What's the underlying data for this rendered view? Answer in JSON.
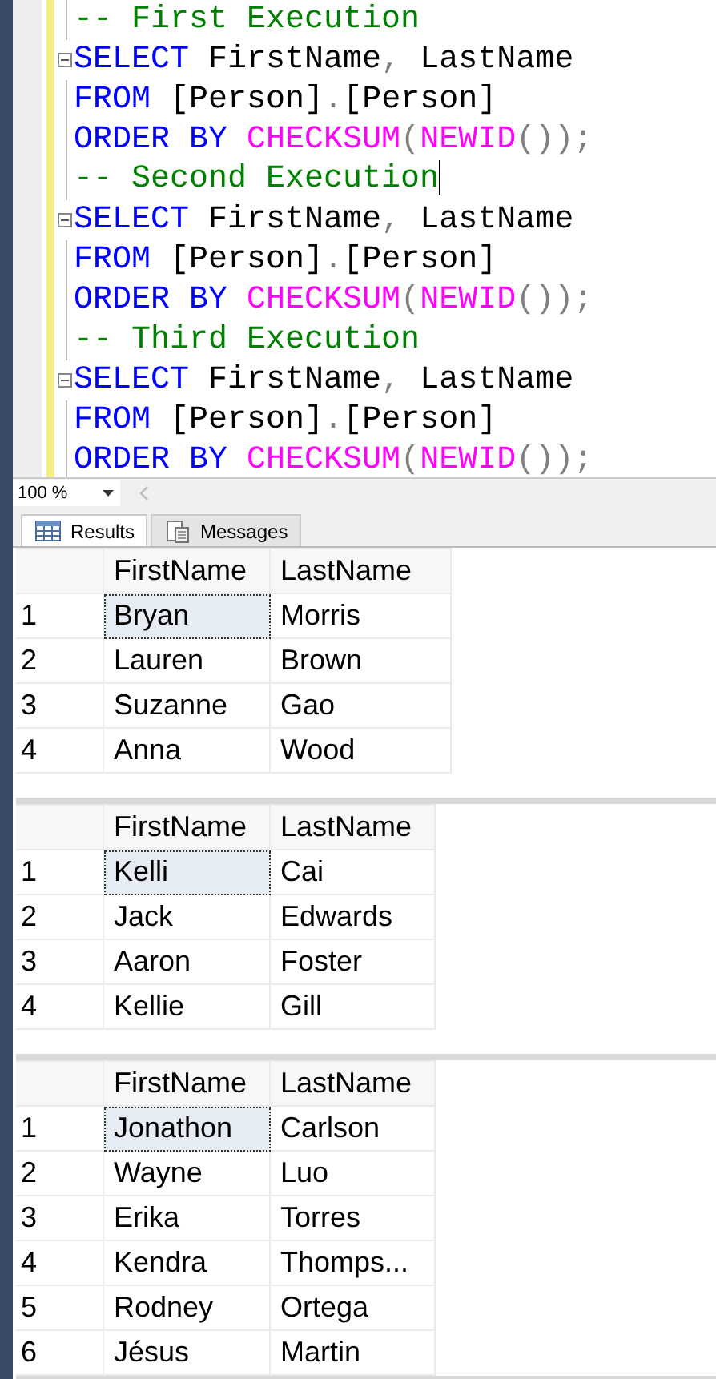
{
  "editor": {
    "lines": [
      {
        "fold": false,
        "caret": false,
        "tokens": [
          {
            "text": "-- First Execution",
            "kind": "comment"
          }
        ]
      },
      {
        "fold": true,
        "caret": false,
        "tokens": [
          {
            "text": "SELECT",
            "kind": "keyword"
          },
          {
            "text": " FirstName",
            "kind": "ident"
          },
          {
            "text": ",",
            "kind": "punct"
          },
          {
            "text": " LastName",
            "kind": "ident"
          }
        ]
      },
      {
        "fold": false,
        "caret": false,
        "tokens": [
          {
            "text": "FROM",
            "kind": "keyword"
          },
          {
            "text": " [Person]",
            "kind": "ident"
          },
          {
            "text": ".",
            "kind": "punct"
          },
          {
            "text": "[Person]",
            "kind": "ident"
          }
        ]
      },
      {
        "fold": false,
        "caret": false,
        "tokens": [
          {
            "text": "ORDER BY",
            "kind": "keyword"
          },
          {
            "text": " CHECKSUM",
            "kind": "function"
          },
          {
            "text": "(",
            "kind": "punct"
          },
          {
            "text": "NEWID",
            "kind": "function"
          },
          {
            "text": "());",
            "kind": "punct"
          }
        ]
      },
      {
        "fold": false,
        "caret": true,
        "tokens": [
          {
            "text": "-- Second Execution",
            "kind": "comment"
          }
        ]
      },
      {
        "fold": true,
        "caret": false,
        "tokens": [
          {
            "text": "SELECT",
            "kind": "keyword"
          },
          {
            "text": " FirstName",
            "kind": "ident"
          },
          {
            "text": ",",
            "kind": "punct"
          },
          {
            "text": " LastName",
            "kind": "ident"
          }
        ]
      },
      {
        "fold": false,
        "caret": false,
        "tokens": [
          {
            "text": "FROM",
            "kind": "keyword"
          },
          {
            "text": " [Person]",
            "kind": "ident"
          },
          {
            "text": ".",
            "kind": "punct"
          },
          {
            "text": "[Person]",
            "kind": "ident"
          }
        ]
      },
      {
        "fold": false,
        "caret": false,
        "tokens": [
          {
            "text": "ORDER BY",
            "kind": "keyword"
          },
          {
            "text": " CHECKSUM",
            "kind": "function"
          },
          {
            "text": "(",
            "kind": "punct"
          },
          {
            "text": "NEWID",
            "kind": "function"
          },
          {
            "text": "());",
            "kind": "punct"
          }
        ]
      },
      {
        "fold": false,
        "caret": false,
        "tokens": [
          {
            "text": "-- Third Execution",
            "kind": "comment"
          }
        ]
      },
      {
        "fold": true,
        "caret": false,
        "tokens": [
          {
            "text": "SELECT",
            "kind": "keyword"
          },
          {
            "text": " FirstName",
            "kind": "ident"
          },
          {
            "text": ",",
            "kind": "punct"
          },
          {
            "text": " LastName",
            "kind": "ident"
          }
        ]
      },
      {
        "fold": false,
        "caret": false,
        "tokens": [
          {
            "text": "FROM",
            "kind": "keyword"
          },
          {
            "text": " [Person]",
            "kind": "ident"
          },
          {
            "text": ".",
            "kind": "punct"
          },
          {
            "text": "[Person]",
            "kind": "ident"
          }
        ]
      },
      {
        "fold": false,
        "caret": false,
        "tokens": [
          {
            "text": "ORDER BY",
            "kind": "keyword"
          },
          {
            "text": " CHECKSUM",
            "kind": "function"
          },
          {
            "text": "(",
            "kind": "punct"
          },
          {
            "text": "NEWID",
            "kind": "function"
          },
          {
            "text": "());",
            "kind": "punct"
          }
        ]
      }
    ]
  },
  "zoom": "100 %",
  "tabs": [
    {
      "label": "Results",
      "selected": true
    },
    {
      "label": "Messages",
      "selected": false
    }
  ],
  "grids": [
    {
      "columns": [
        "FirstName",
        "LastName"
      ],
      "rows": [
        {
          "num": "1",
          "selected": true,
          "cells": [
            "Bryan",
            "Morris"
          ]
        },
        {
          "num": "2",
          "selected": false,
          "cells": [
            "Lauren",
            "Brown"
          ]
        },
        {
          "num": "3",
          "selected": false,
          "cells": [
            "Suzanne",
            "Gao"
          ]
        },
        {
          "num": "4",
          "selected": false,
          "cells": [
            "Anna",
            "Wood"
          ]
        }
      ]
    },
    {
      "columns": [
        "FirstName",
        "LastName"
      ],
      "rows": [
        {
          "num": "1",
          "selected": true,
          "cells": [
            "Kelli",
            "Cai"
          ]
        },
        {
          "num": "2",
          "selected": false,
          "cells": [
            "Jack",
            "Edwards"
          ]
        },
        {
          "num": "3",
          "selected": false,
          "cells": [
            "Aaron",
            "Foster"
          ]
        },
        {
          "num": "4",
          "selected": false,
          "cells": [
            "Kellie",
            "Gill"
          ]
        }
      ]
    },
    {
      "columns": [
        "FirstName",
        "LastName"
      ],
      "rows": [
        {
          "num": "1",
          "selected": true,
          "cells": [
            "Jonathon",
            "Carlson"
          ]
        },
        {
          "num": "2",
          "selected": false,
          "cells": [
            "Wayne",
            "Luo"
          ]
        },
        {
          "num": "3",
          "selected": false,
          "cells": [
            "Erika",
            "Torres"
          ]
        },
        {
          "num": "4",
          "selected": false,
          "cells": [
            "Kendra",
            "Thomps..."
          ]
        },
        {
          "num": "5",
          "selected": false,
          "cells": [
            "Rodney",
            "Ortega"
          ]
        },
        {
          "num": "6",
          "selected": false,
          "cells": [
            "Jésus",
            "Martin"
          ]
        }
      ]
    }
  ]
}
